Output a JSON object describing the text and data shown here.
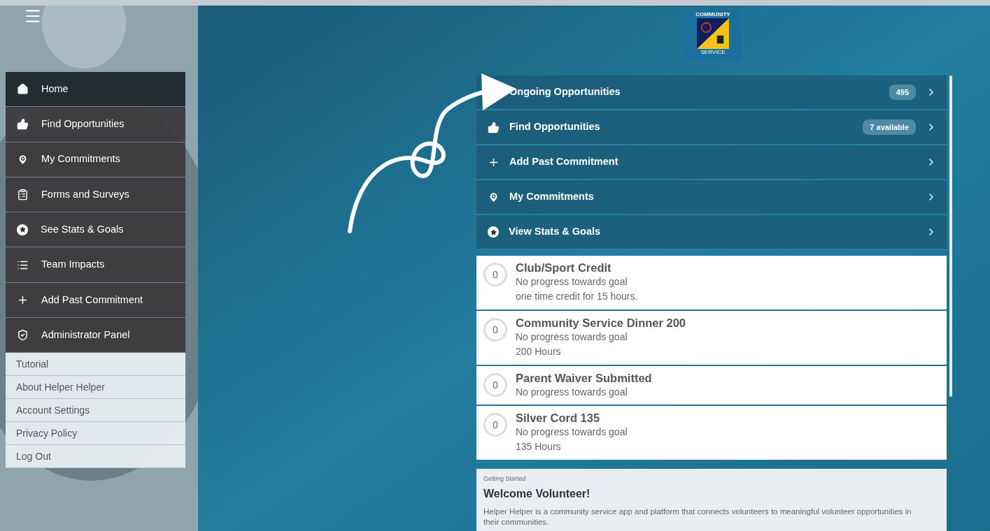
{
  "logo": {
    "top": "COMMUNITY",
    "bottom": "SERVICE"
  },
  "sidebar": {
    "items": [
      {
        "label": "Home",
        "selected": true
      },
      {
        "label": "Find Opportunities",
        "selected": false
      },
      {
        "label": "My Commitments",
        "selected": false
      },
      {
        "label": "Forms and Surveys",
        "selected": false
      },
      {
        "label": "See Stats & Goals",
        "selected": false
      },
      {
        "label": "Team Impacts",
        "selected": false
      },
      {
        "label": "Add Past Commitment",
        "selected": false
      },
      {
        "label": "Administrator Panel",
        "selected": false
      }
    ],
    "links": [
      "Tutorial",
      "About Helper Helper",
      "Account Settings",
      "Privacy Policy",
      "Log Out"
    ]
  },
  "menu": [
    {
      "label": "Ongoing Opportunities",
      "badge": "495"
    },
    {
      "label": "Find Opportunities",
      "badge": "7 available"
    },
    {
      "label": "Add Past Commitment"
    },
    {
      "label": "My Commitments"
    },
    {
      "label": "View Stats & Goals"
    }
  ],
  "goals": [
    {
      "count": "0",
      "level": 0,
      "title": "Club/Sport Credit",
      "progress": "No progress towards goal",
      "note": "one time credit for 15 hours."
    },
    {
      "count": "0",
      "level": 0,
      "title": "Community Service Dinner 200",
      "progress": "No progress towards goal",
      "note": "200 Hours"
    },
    {
      "count": "0",
      "level": 0,
      "title": "Parent Waiver Submitted",
      "progress": "No progress towards goal"
    },
    {
      "count": "0",
      "level": 0,
      "title": "Silver Cord 135",
      "progress": "No progress towards goal",
      "note": "135 Hours"
    }
  ],
  "welcome": {
    "eyebrow": "Getting Started",
    "title": "Welcome Volunteer!",
    "body": "Helper Helper is a community service app and platform that connects volunteers to meaningful volunteer opportunities in their communities."
  }
}
